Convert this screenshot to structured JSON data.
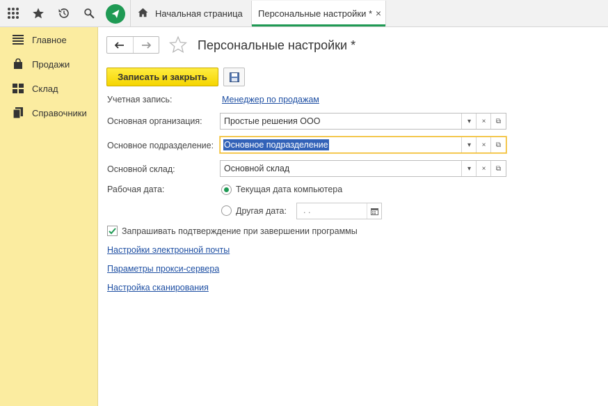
{
  "topbar": {
    "icons": [
      "apps-grid-icon",
      "favorites-star-icon",
      "history-icon",
      "search-icon",
      "app-logo-icon"
    ],
    "tabs": [
      {
        "label": "Начальная страница"
      },
      {
        "label": "Персональные настройки *",
        "close": "×"
      }
    ]
  },
  "sidebar": {
    "items": [
      {
        "label": "Главное",
        "icon": "menu-lines-icon"
      },
      {
        "label": "Продажи",
        "icon": "shopping-bag-icon"
      },
      {
        "label": "Склад",
        "icon": "warehouse-grid-icon"
      },
      {
        "label": "Справочники",
        "icon": "books-icon"
      }
    ]
  },
  "page": {
    "title": "Персональные настройки *",
    "save_close": "Записать и закрыть"
  },
  "form": {
    "account_label": "Учетная запись:",
    "account_value": "Менеджер по продажам",
    "org_label": "Основная организация:",
    "org_value": "Простые решения ООО",
    "dept_label": "Основное подразделение:",
    "dept_value": "Основное подразделение",
    "warehouse_label": "Основной склад:",
    "warehouse_value": "Основной склад",
    "workdate_label": "Рабочая дата:",
    "radio_current": "Текущая дата компьютера",
    "radio_other": "Другая дата:",
    "date_value": ".  .",
    "confirm_exit": "Запрашивать подтверждение при завершении программы",
    "confirm_checked": true,
    "selected_radio": "current"
  },
  "links": {
    "email": "Настройки электронной почты",
    "proxy": "Параметры прокси-сервера",
    "scan": "Настройка сканирования"
  },
  "colors": {
    "accent_green": "#1f9a54",
    "sidebar_bg": "#fbeca0",
    "save_button": "#f5d500",
    "link": "#1e4fa3",
    "focus_border": "#f2b926"
  }
}
